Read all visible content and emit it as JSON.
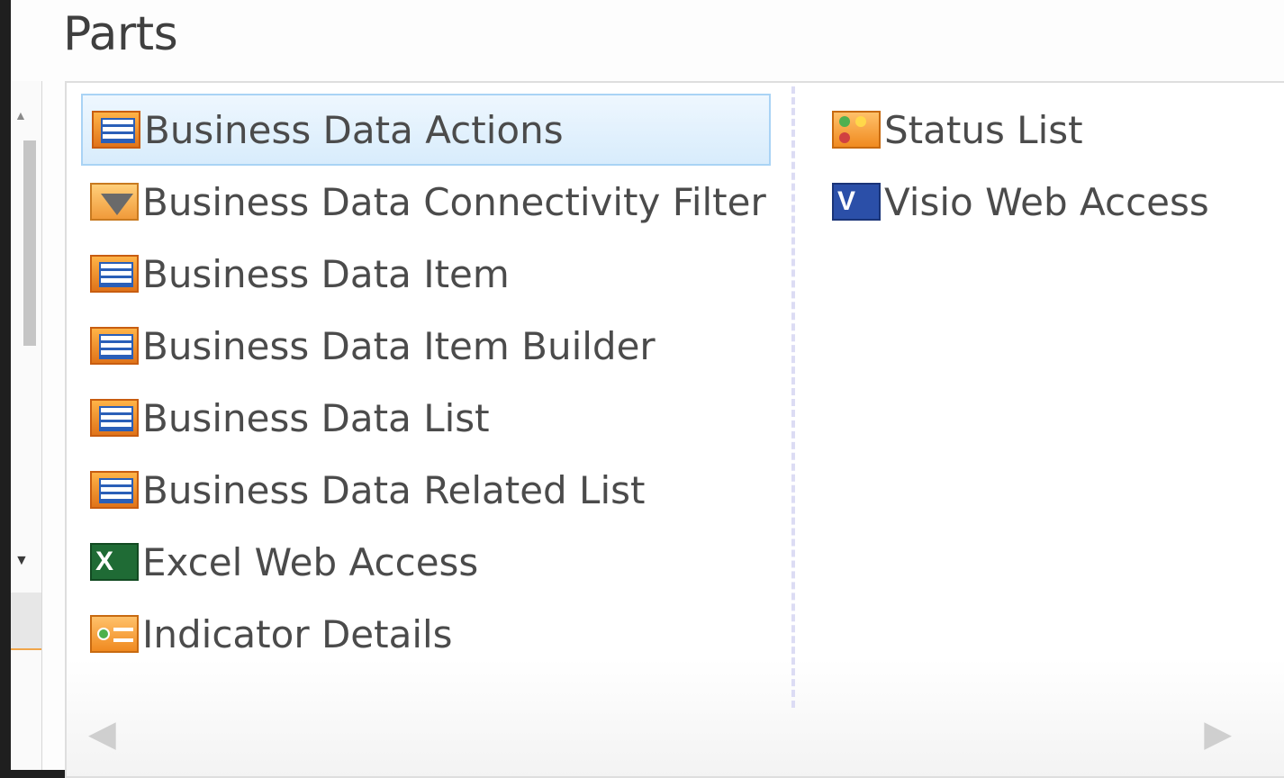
{
  "panel": {
    "title": "Parts",
    "columns": [
      {
        "items": [
          {
            "label": "Business Data Actions",
            "icon": "web-part-icon",
            "selected": true
          },
          {
            "label": "Business Data Connectivity Filter",
            "icon": "filter-icon",
            "selected": false
          },
          {
            "label": "Business Data Item",
            "icon": "web-part-icon",
            "selected": false
          },
          {
            "label": "Business Data Item Builder",
            "icon": "web-part-icon",
            "selected": false
          },
          {
            "label": "Business Data List",
            "icon": "web-part-icon",
            "selected": false
          },
          {
            "label": "Business Data Related List",
            "icon": "web-part-icon",
            "selected": false
          },
          {
            "label": "Excel Web Access",
            "icon": "excel-icon",
            "selected": false
          },
          {
            "label": "Indicator Details",
            "icon": "indicator-icon",
            "selected": false
          }
        ]
      },
      {
        "items": [
          {
            "label": "Status List",
            "icon": "status-list-icon",
            "selected": false
          },
          {
            "label": "Visio Web Access",
            "icon": "visio-icon",
            "selected": false
          }
        ]
      }
    ],
    "icon_text": {
      "excel": "X",
      "visio": "V"
    },
    "nav": {
      "left": "◀",
      "right": "▶"
    }
  },
  "colors": {
    "selected_border": "#a9d3f5",
    "selected_bg": "#d8ecfc",
    "text": "#4b4b4b"
  }
}
